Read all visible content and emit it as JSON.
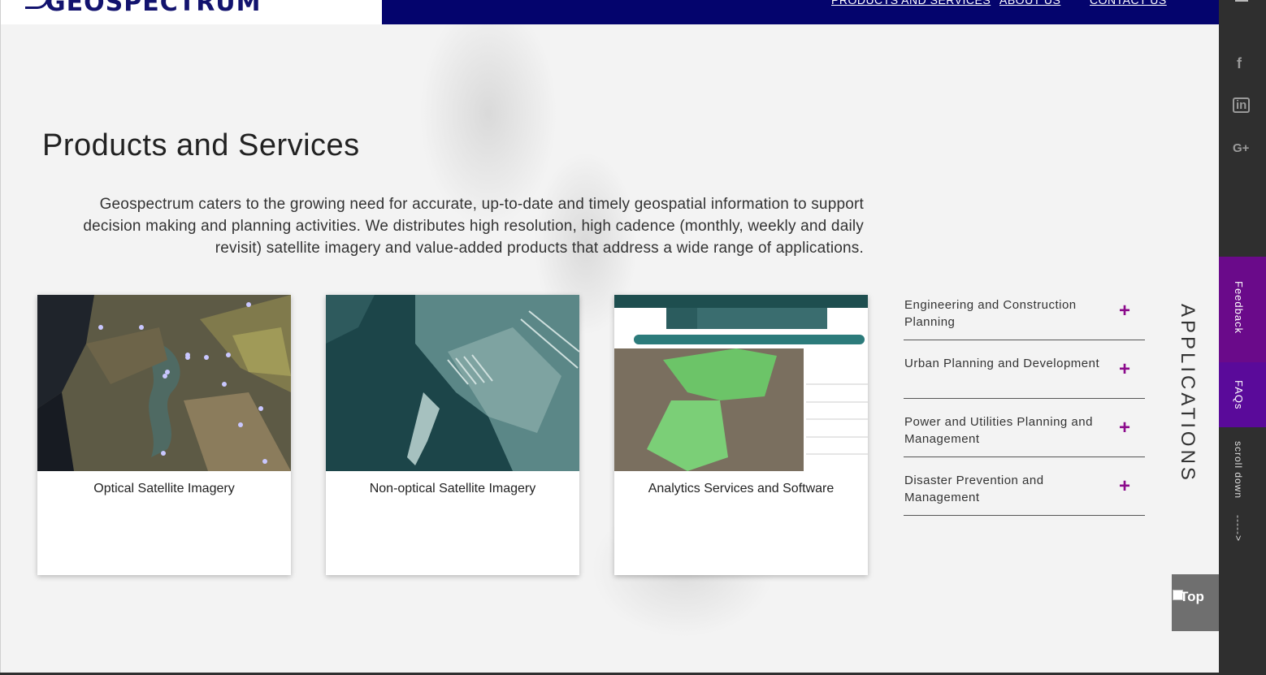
{
  "header": {
    "logo_text": "GEOSPECTRUM",
    "nav": [
      "PRODUCTS AND SERVICES",
      "ABOUT US",
      "CONTACT US"
    ]
  },
  "main": {
    "title": "Products and Services",
    "intro": "Geospectrum caters to the growing need for accurate, up-to-date and timely geospatial information to support decision making and planning activities. We distributes high resolution, high cadence (monthly, weekly and daily revisit) satellite imagery and value-added products that address a wide range of applications.",
    "cards": [
      {
        "label": "Optical Satellite Imagery"
      },
      {
        "label": "Non-optical Satellite Imagery"
      },
      {
        "label": "Analytics Services and Software"
      }
    ]
  },
  "applications": {
    "heading": "APPLICATIONS",
    "items": [
      {
        "label": "Engineering and Construction Planning",
        "icon": "+"
      },
      {
        "label": "Urban Planning and Development",
        "icon": "+"
      },
      {
        "label": "Power and Utilities Planning and Management",
        "icon": "+"
      },
      {
        "label": "Disaster Prevention and Management",
        "icon": "+"
      }
    ]
  },
  "rail": {
    "menu_icon": "hamburger-icon",
    "social": [
      {
        "name": "facebook-icon",
        "glyph": "f"
      },
      {
        "name": "linkedin-icon",
        "glyph": "in"
      },
      {
        "name": "google-plus-icon",
        "glyph": "G+"
      }
    ],
    "feedback": "Feedback",
    "faqs": "FAQs",
    "scroll": "scroll down",
    "scroll_arrow": "----->"
  },
  "top_button": {
    "label": "Top"
  },
  "colors": {
    "nav_bg": "#04046d",
    "accent_plus": "#8b0a8b",
    "feedback_bg": "#6a0a8a",
    "faqs_bg": "#5a0a9a"
  }
}
